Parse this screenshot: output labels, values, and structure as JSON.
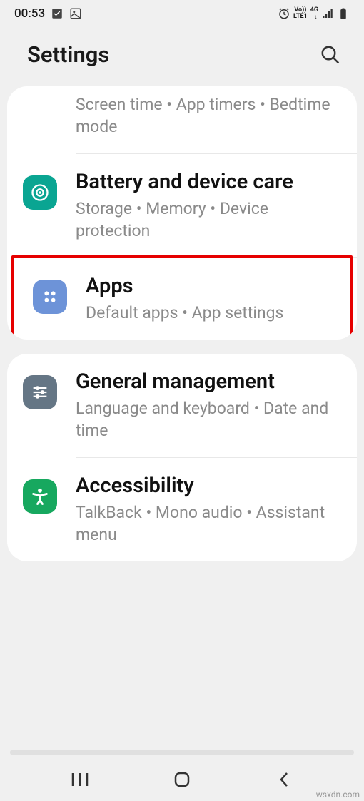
{
  "status": {
    "time": "00:53",
    "icons_left": [
      "checkbox-icon",
      "image-icon"
    ],
    "icons_right": [
      "alarm-icon",
      "volte-icon",
      "4g-icon",
      "signal-icon",
      "battery-icon"
    ],
    "volte_text": "Vo))\nLTE1",
    "net_text": "4G"
  },
  "header": {
    "title": "Settings"
  },
  "rows": {
    "digital": {
      "sub": "Screen time  •  App timers  •  Bedtime mode"
    },
    "battery": {
      "title": "Battery and device care",
      "sub": "Storage  •  Memory  •  Device protection"
    },
    "apps": {
      "title": "Apps",
      "sub": "Default apps  •  App settings"
    },
    "general": {
      "title": "General management",
      "sub": "Language and keyboard  •  Date and time"
    },
    "accessibility": {
      "title": "Accessibility",
      "sub": "TalkBack  •  Mono audio  •  Assistant menu"
    }
  },
  "watermark": "wsxdn.com"
}
